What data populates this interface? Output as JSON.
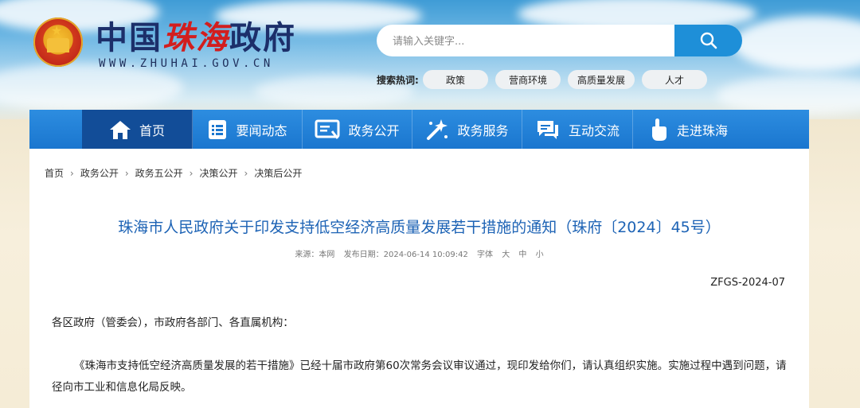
{
  "header": {
    "logo_cn_prefix": "中国",
    "logo_cn_city": "珠海",
    "logo_cn_suffix": "政府",
    "logo_en": "WWW.ZHUHAI.GOV.CN",
    "search_placeholder": "请输入关键字...",
    "hot_label": "搜索热词:",
    "hot_tags": [
      "政策",
      "营商环境",
      "高质量发展",
      "人才"
    ]
  },
  "nav": {
    "items": [
      {
        "label": "首页",
        "icon": "home-icon"
      },
      {
        "label": "要闻动态",
        "icon": "news-list-icon"
      },
      {
        "label": "政务公开",
        "icon": "document-icon"
      },
      {
        "label": "政务服务",
        "icon": "service-sparkle-icon"
      },
      {
        "label": "互动交流",
        "icon": "chat-bubble-icon"
      },
      {
        "label": "走进珠海",
        "icon": "hand-pointer-icon"
      }
    ],
    "active_index": 0
  },
  "breadcrumb": [
    "首页",
    "政务公开",
    "政务五公开",
    "决策公开",
    "决策后公开"
  ],
  "article": {
    "title": "珠海市人民政府关于印发支持低空经济高质量发展若干措施的通知（珠府〔2024〕45号）",
    "source": "来源：本网",
    "date": "发布日期：2024-06-14 10:09:42",
    "font_label": "字体",
    "font_large": "大",
    "font_medium": "中",
    "font_small": "小",
    "doc_number": "ZFGS-2024-07",
    "salutation": "各区政府（管委会），市政府各部门、各直属机构：",
    "body": "《珠海市支持低空经济高质量发展的若干措施》已经十届市政府第60次常务会议审议通过，现印发给你们，请认真组织实施。实施过程中遇到问题，请径向市工业和信息化局反映。"
  },
  "colors": {
    "nav_blue": "#1a76cf",
    "nav_active": "#124d98",
    "title_blue": "#1d63b5",
    "search_button": "#1e8fd8"
  }
}
